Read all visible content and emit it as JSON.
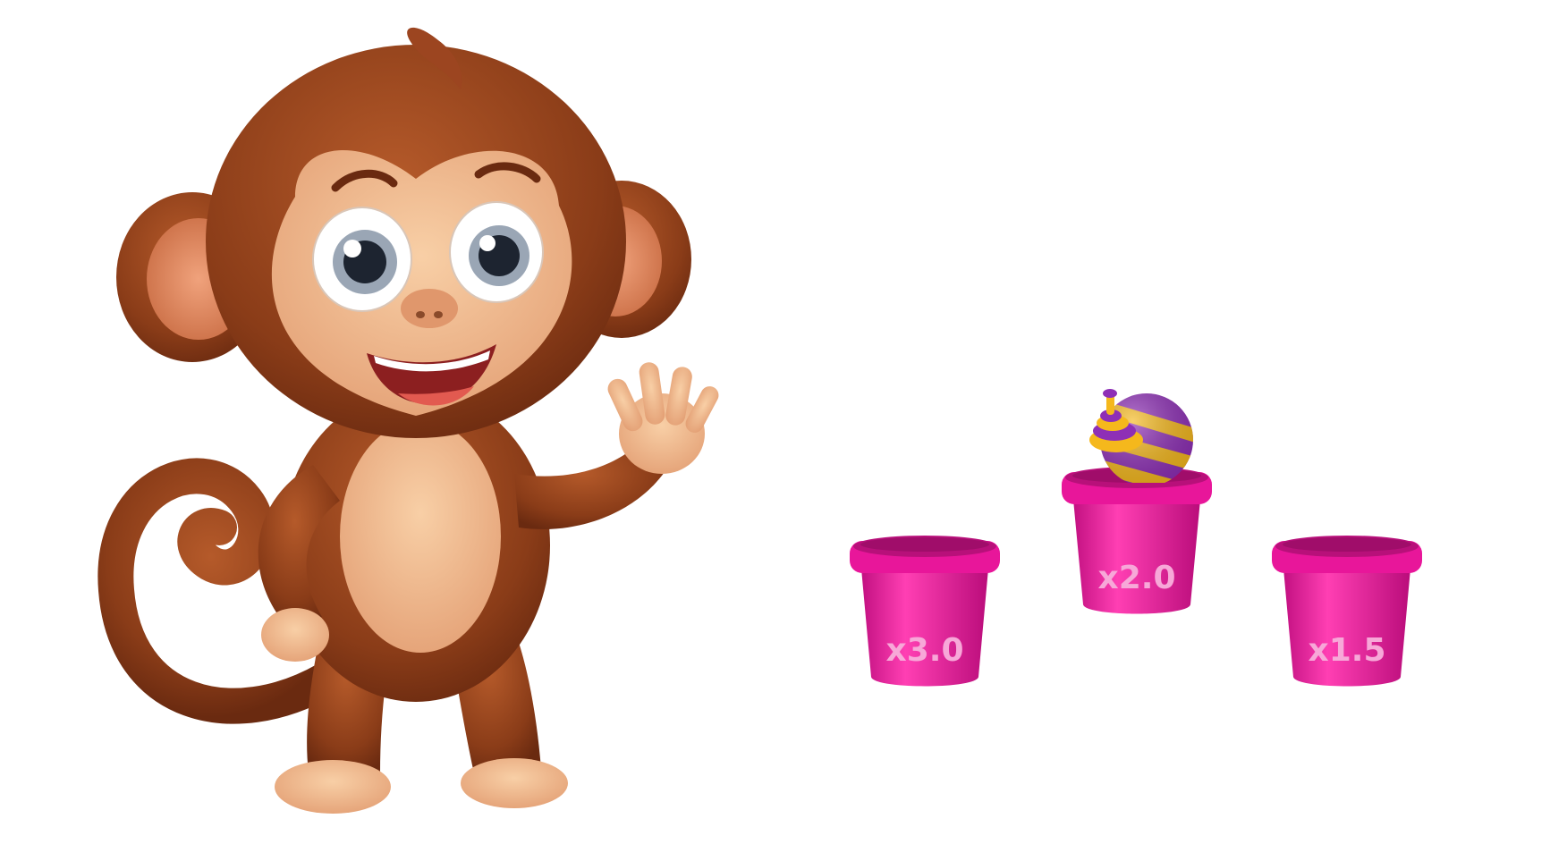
{
  "game": {
    "cups": [
      {
        "multiplier": "x3.0",
        "has_ball": false
      },
      {
        "multiplier": "x2.0",
        "has_ball": true
      },
      {
        "multiplier": "x1.5",
        "has_ball": false
      }
    ]
  },
  "colors": {
    "background": "#ffffff",
    "cup": "#e8169a",
    "cup_dark": "#b8107a",
    "cup_rim": "#f04cb8",
    "multiplier_text": "#f7a8d8",
    "ball_purple": "#8e2fb6",
    "ball_yellow": "#f5b81c",
    "monkey_fur": "#8a3c18",
    "monkey_skin": "#f2b78c"
  }
}
